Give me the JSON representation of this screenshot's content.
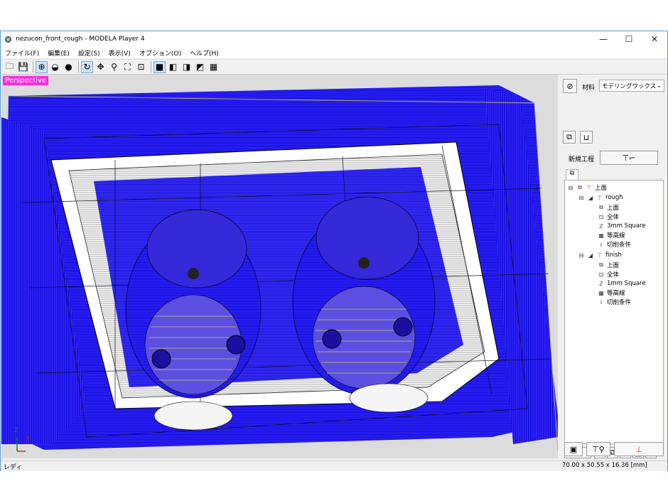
{
  "window": {
    "title": "nezucon_front_rough - MODELA Player 4",
    "controls": [
      "—",
      "☐",
      "✕"
    ]
  },
  "menu": [
    "ファイル(F)",
    "編集(E)",
    "設定(S)",
    "表示(V)",
    "オプション(O)",
    "ヘルプ(H)"
  ],
  "viewport": {
    "label": "Perspective",
    "axis_z": "Z",
    "axis_x": "X"
  },
  "panel": {
    "material_label": "材料",
    "material_value": "モデリングワックス",
    "new_process_label": "新規工程",
    "tree": {
      "root": "上面",
      "rough": {
        "label": "rough",
        "children": [
          "上面",
          "全体",
          "3mm Square",
          "等高線",
          "切削条件"
        ]
      },
      "finish": {
        "label": "finish",
        "children": [
          "上面",
          "全体",
          "1mm Square",
          "等高線",
          "切削条件"
        ]
      }
    }
  },
  "status": {
    "left": "レディ",
    "right": "70.00 x 50.55 x 16.36 [mm]"
  },
  "colors": {
    "toolpath": "#1a00ff",
    "perspective_badge": "#ff2bdc"
  }
}
